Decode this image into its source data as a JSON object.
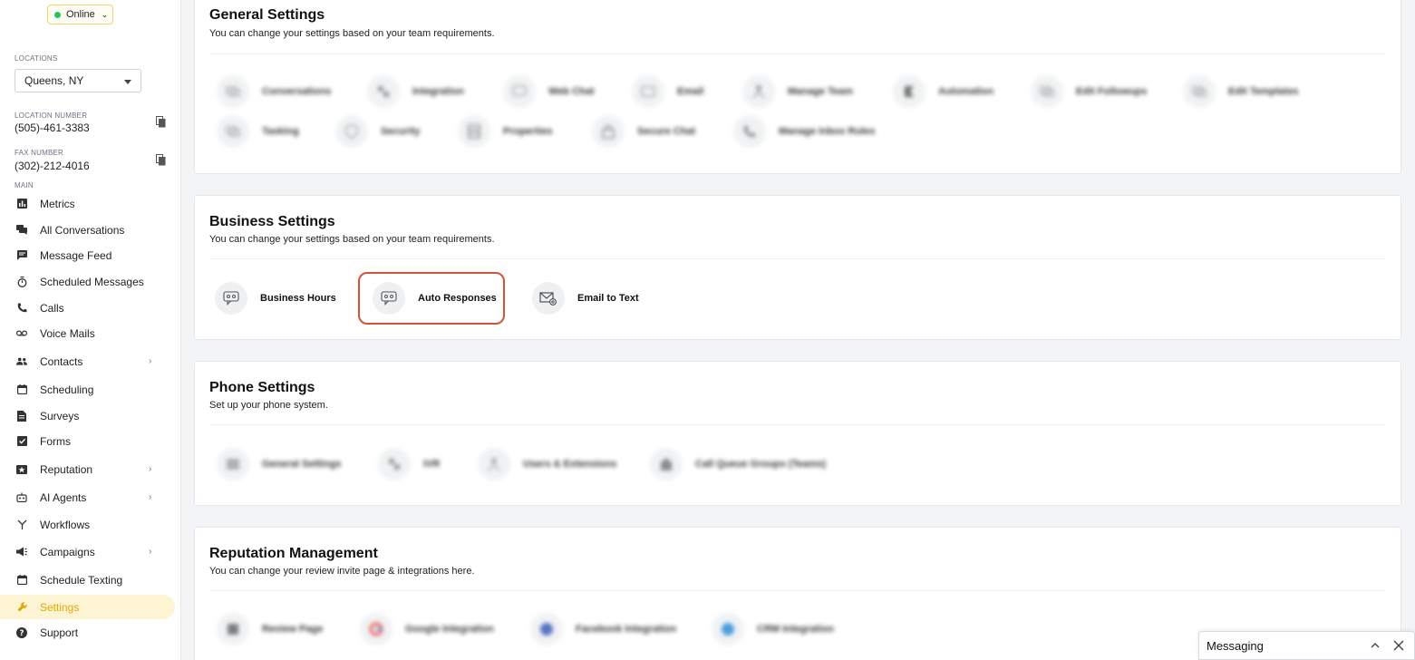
{
  "sidebar": {
    "status": "Online",
    "locations_label": "LOCATIONS",
    "location": "Queens, NY",
    "location_number_label": "LOCATION NUMBER",
    "location_number": "(505)-461-3383",
    "fax_number_label": "FAX NUMBER",
    "fax_number": "(302)-212-4016",
    "main_label": "MAIN",
    "items": [
      {
        "label": "Metrics"
      },
      {
        "label": "All Conversations"
      },
      {
        "label": "Message Feed"
      },
      {
        "label": "Scheduled Messages"
      },
      {
        "label": "Calls"
      },
      {
        "label": "Voice Mails"
      },
      {
        "label": "Contacts"
      },
      {
        "label": "Scheduling"
      },
      {
        "label": "Surveys"
      },
      {
        "label": "Forms"
      },
      {
        "label": "Reputation"
      },
      {
        "label": "AI Agents"
      },
      {
        "label": "Workflows"
      },
      {
        "label": "Campaigns"
      },
      {
        "label": "Schedule Texting"
      },
      {
        "label": "Settings"
      },
      {
        "label": "Support"
      }
    ]
  },
  "general": {
    "title": "General Settings",
    "subtitle": "You can change your settings based on your team requirements.",
    "items": [
      "Conversations",
      "Integration",
      "Web Chat",
      "Email",
      "Manage Team",
      "Automation",
      "Edit Followups",
      "Edit Templates",
      "Tasking",
      "Security",
      "Properties",
      "Secure Chat",
      "Manage Inbox Rules"
    ]
  },
  "business": {
    "title": "Business Settings",
    "subtitle": "You can change your settings based on your team requirements.",
    "items": [
      "Business Hours",
      "Auto Responses",
      "Email to Text"
    ]
  },
  "phone": {
    "title": "Phone Settings",
    "subtitle": "Set up your phone system.",
    "items": [
      "General Settings",
      "IVR",
      "Users & Extensions",
      "Call Queue Groups (Teams)"
    ]
  },
  "reputation": {
    "title": "Reputation Management",
    "subtitle": "You can change your review invite page & integrations here.",
    "items": [
      "Review Page",
      "Google Integration",
      "Facebook Integration",
      "CRM Integration"
    ]
  },
  "messaging": {
    "label": "Messaging"
  },
  "colors": {
    "accent": "#e0a800",
    "highlight": "#d0533b",
    "online": "#22c55e"
  }
}
